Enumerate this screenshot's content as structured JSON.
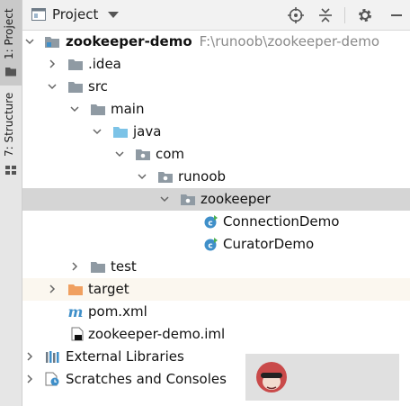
{
  "strip": {
    "project_tab": "1: Project",
    "structure_tab": "7: Structure"
  },
  "header": {
    "title": "Project"
  },
  "tree": {
    "root": {
      "name": "zookeeper-demo",
      "path": "F:\\runoob\\zookeeper-demo"
    },
    "idea": ".idea",
    "src": "src",
    "main": "main",
    "java": "java",
    "com": "com",
    "runoob": "runoob",
    "zookeeper": "zookeeper",
    "connection_demo": "ConnectionDemo",
    "curator_demo": "CuratorDemo",
    "test": "test",
    "target": "target",
    "pom": "pom.xml",
    "iml": "zookeeper-demo.iml",
    "external_libraries": "External Libraries",
    "scratches": "Scratches and Consoles"
  },
  "colors": {
    "folder_gray": "#8f9aa3",
    "folder_blue": "#7cc3e7",
    "folder_orange": "#f0a060",
    "class_blue": "#3f8fc9",
    "selected_bg": "#d5d5d5"
  }
}
